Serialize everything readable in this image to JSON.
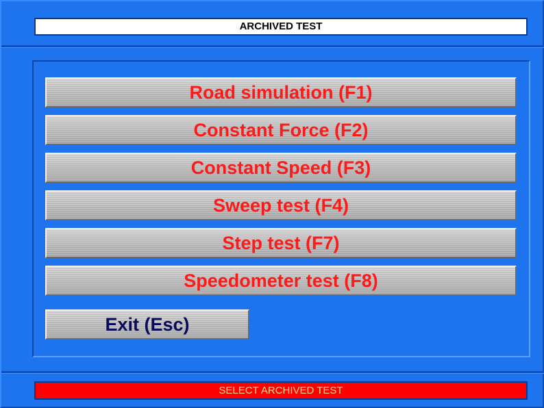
{
  "window": {
    "title": "ARCHIVED TEST"
  },
  "menu": {
    "buttons": [
      {
        "label": "Road simulation (F1)"
      },
      {
        "label": "Constant Force (F2)"
      },
      {
        "label": "Constant Speed (F3)"
      },
      {
        "label": "Sweep test (F4)"
      },
      {
        "label": "Step test (F7)"
      },
      {
        "label": "Speedometer test (F8)"
      }
    ],
    "exit_label": "Exit (Esc)"
  },
  "status": {
    "text": "SELECT ARCHIVED TEST"
  },
  "colors": {
    "background": "#1e74ee",
    "button_text": "#ff1a1a",
    "exit_text": "#0a0a5a",
    "status_background": "#ff0000",
    "status_text": "#ffe08a"
  }
}
